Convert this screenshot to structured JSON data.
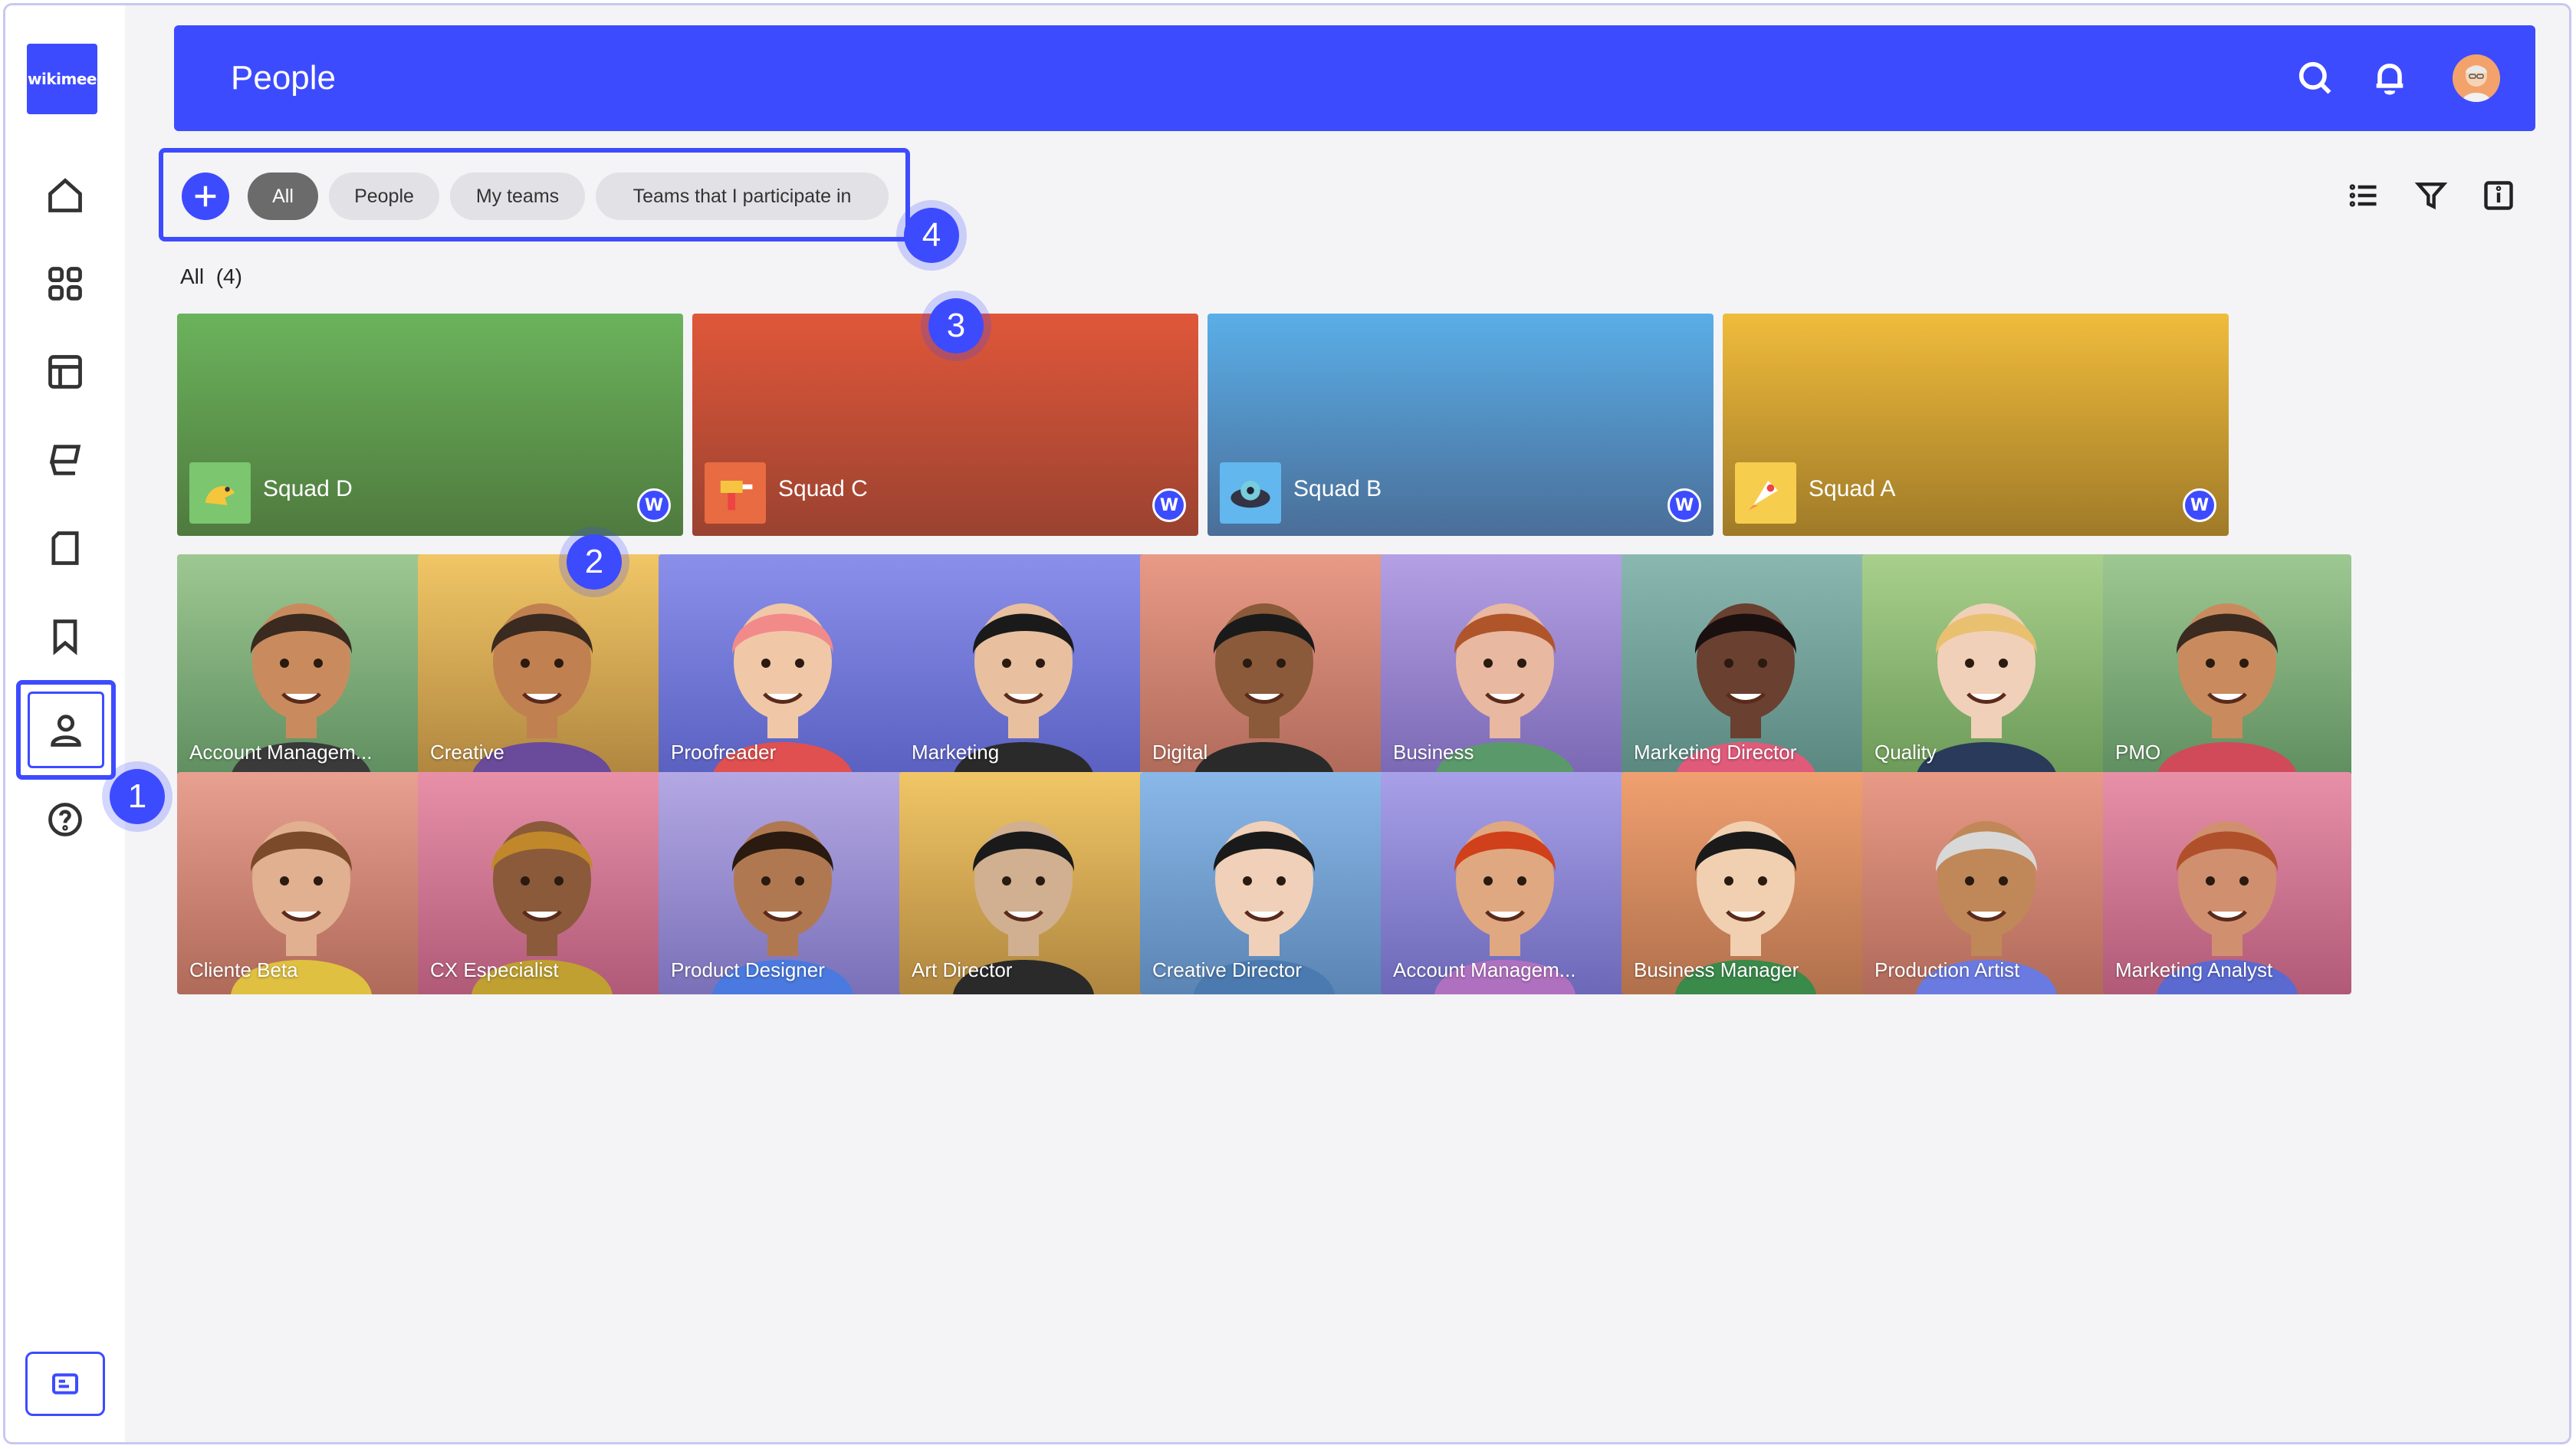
{
  "app": {
    "logo_text": "wikimee"
  },
  "header": {
    "title": "People"
  },
  "filters": {
    "chips": [
      {
        "label": "All",
        "active": true
      },
      {
        "label": "People",
        "active": false
      },
      {
        "label": "My teams",
        "active": false
      },
      {
        "label": "Teams that I participate in",
        "active": false
      }
    ]
  },
  "summary": {
    "label": "All",
    "count": "(4)"
  },
  "badges": [
    "1",
    "2",
    "3",
    "4"
  ],
  "teams": [
    {
      "name": "Squad D",
      "badge": "W",
      "color_top": "#6bb35c",
      "color_bottom": "#4f7a3e"
    },
    {
      "name": "Squad C",
      "badge": "W",
      "color_top": "#e0573a",
      "color_bottom": "#9a4230"
    },
    {
      "name": "Squad B",
      "badge": "W",
      "color_top": "#5aaee8",
      "color_bottom": "#4a6e98"
    },
    {
      "name": "Squad A",
      "badge": "W",
      "color_top": "#f0bc3c",
      "color_bottom": "#9f7a28"
    }
  ],
  "people": [
    {
      "role": "Account Managem..."
    },
    {
      "role": "Creative"
    },
    {
      "role": "Proofreader"
    },
    {
      "role": "Marketing"
    },
    {
      "role": "Digital"
    },
    {
      "role": "Business"
    },
    {
      "role": "Marketing Director"
    },
    {
      "role": "Quality"
    },
    {
      "role": "PMO"
    },
    {
      "role": "Cliente Beta"
    },
    {
      "role": "CX Especialist"
    },
    {
      "role": "Product Designer"
    },
    {
      "role": "Art Director"
    },
    {
      "role": "Creative Director"
    },
    {
      "role": "Account Managem..."
    },
    {
      "role": "Business Manager"
    },
    {
      "role": "Production Artist"
    },
    {
      "role": "Marketing Analyst"
    }
  ],
  "colors": {
    "accent": "#3d4bff"
  }
}
